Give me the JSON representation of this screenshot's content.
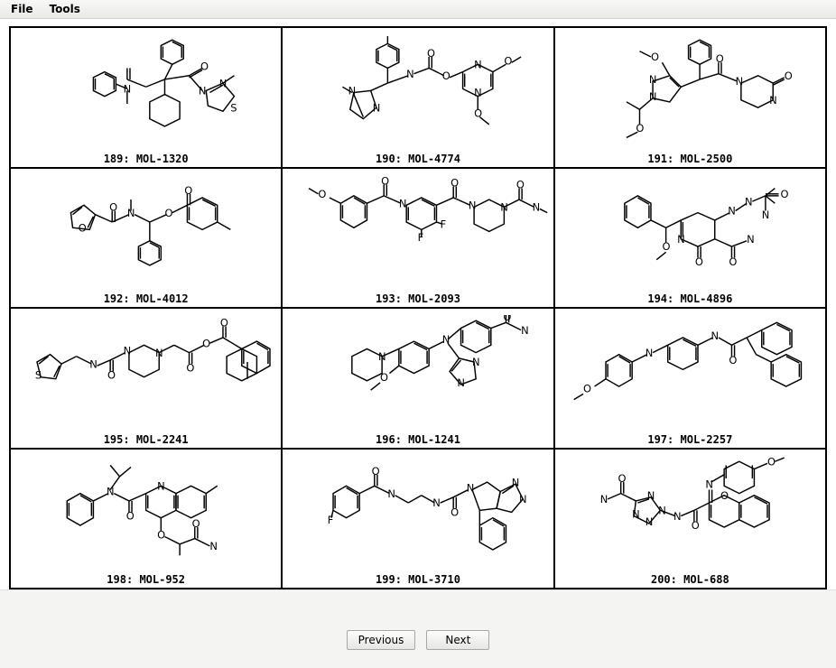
{
  "menu": {
    "file": "File",
    "tools": "Tools"
  },
  "molecules": [
    {
      "index": 189,
      "id": "MOL-1320"
    },
    {
      "index": 190,
      "id": "MOL-4774"
    },
    {
      "index": 191,
      "id": "MOL-2500"
    },
    {
      "index": 192,
      "id": "MOL-4012"
    },
    {
      "index": 193,
      "id": "MOL-2093"
    },
    {
      "index": 194,
      "id": "MOL-4896"
    },
    {
      "index": 195,
      "id": "MOL-2241"
    },
    {
      "index": 196,
      "id": "MOL-1241"
    },
    {
      "index": 197,
      "id": "MOL-2257"
    },
    {
      "index": 198,
      "id": "MOL-952"
    },
    {
      "index": 199,
      "id": "MOL-3710"
    },
    {
      "index": 200,
      "id": "MOL-688"
    }
  ],
  "nav": {
    "previous": "Previous",
    "next": "Next"
  }
}
